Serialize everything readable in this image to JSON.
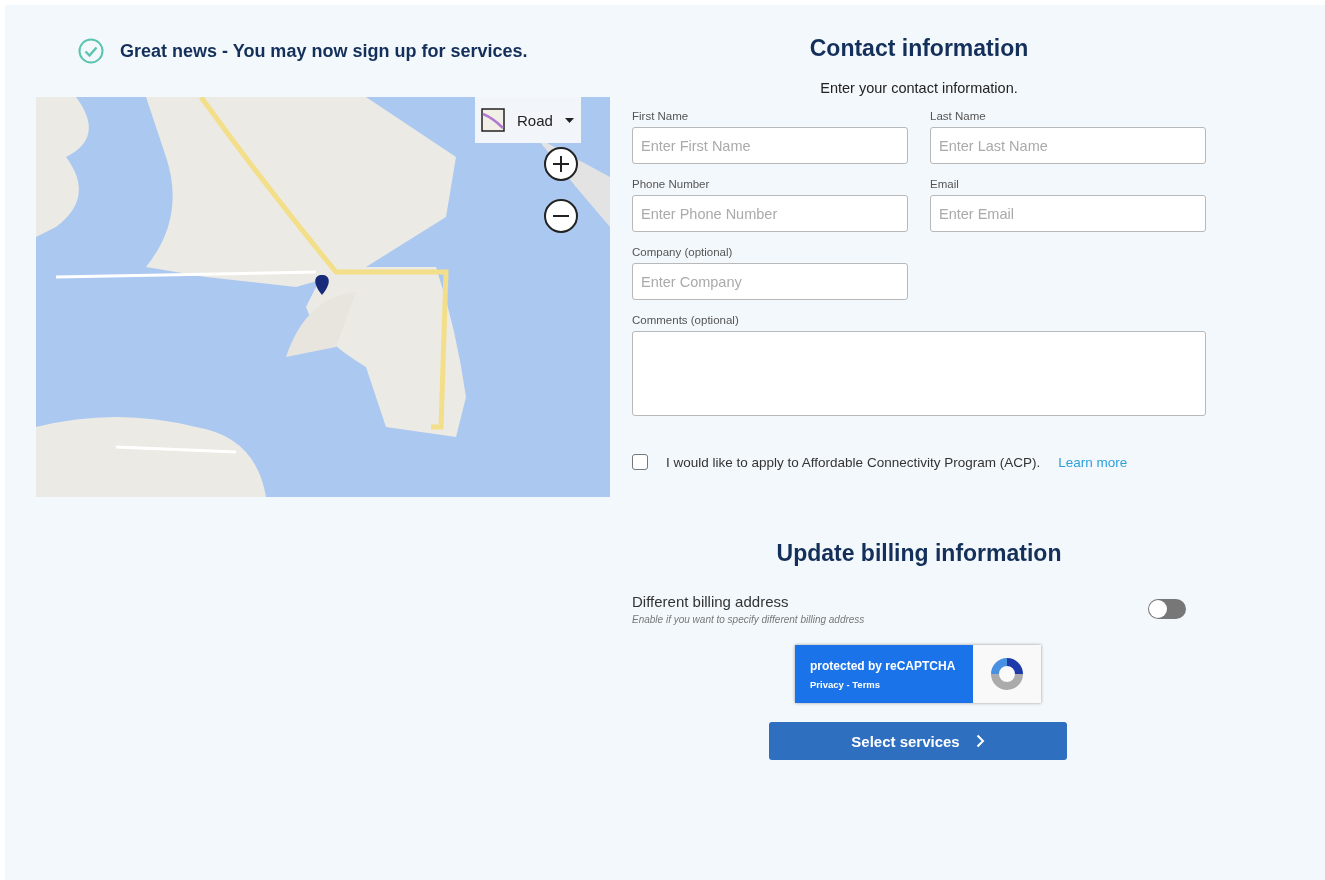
{
  "notice": {
    "text": "Great news - You may now sign up for services."
  },
  "map": {
    "kind": "picture",
    "style_selector": {
      "label": "Road"
    }
  },
  "contact": {
    "title": "Contact information",
    "subtitle": "Enter your contact information.",
    "fields": [
      {
        "kind": "input",
        "label": "First Name",
        "placeholder": "Enter First Name"
      },
      {
        "kind": "input",
        "label": "Last Name",
        "placeholder": "Enter Last Name"
      },
      {
        "kind": "input",
        "label": "Phone Number",
        "placeholder": "Enter Phone Number"
      },
      {
        "kind": "input",
        "label": "Email",
        "placeholder": "Enter Email"
      },
      {
        "kind": "input",
        "label": "Company (optional)",
        "placeholder": "Enter Company"
      },
      {
        "kind": "textarea",
        "label": "Comments (optional)"
      }
    ],
    "acp": {
      "checked": false,
      "text": "I would like to apply to Affordable Connectivity Program (ACP).",
      "link": "Learn more"
    }
  },
  "billing": {
    "title": "Update billing information",
    "toggle": {
      "label": "Different billing address",
      "hint": "Enable if you want to specify different billing address",
      "on": false
    }
  },
  "recaptcha": {
    "title": "protected by reCAPTCHA",
    "footer": "Privacy - Terms"
  },
  "submit": {
    "label": "Select services"
  }
}
